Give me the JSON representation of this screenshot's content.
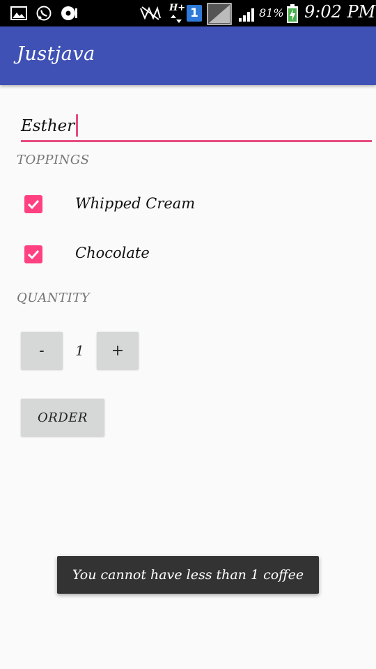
{
  "status_bar": {
    "battery": "81%",
    "time": "9:02 PM",
    "network_type": "H+",
    "sim_badge": "1"
  },
  "app_bar": {
    "title": "Justjava"
  },
  "name_field": {
    "value": "Esther"
  },
  "toppings": {
    "header": "TOPPINGS",
    "items": [
      {
        "label": "Whipped Cream",
        "checked": true
      },
      {
        "label": "Chocolate",
        "checked": true
      }
    ]
  },
  "quantity": {
    "header": "QUANTITY",
    "decrement_label": "-",
    "increment_label": "+",
    "value": "1"
  },
  "order_button": {
    "label": "ORDER"
  },
  "toast": {
    "message": "You cannot have less than 1 coffee"
  },
  "colors": {
    "primary": "#3f51b5",
    "accent": "#ff4081",
    "status_bar": "#000000",
    "background": "#fafafa",
    "button": "#d6d7d7",
    "toast": "#333333"
  }
}
